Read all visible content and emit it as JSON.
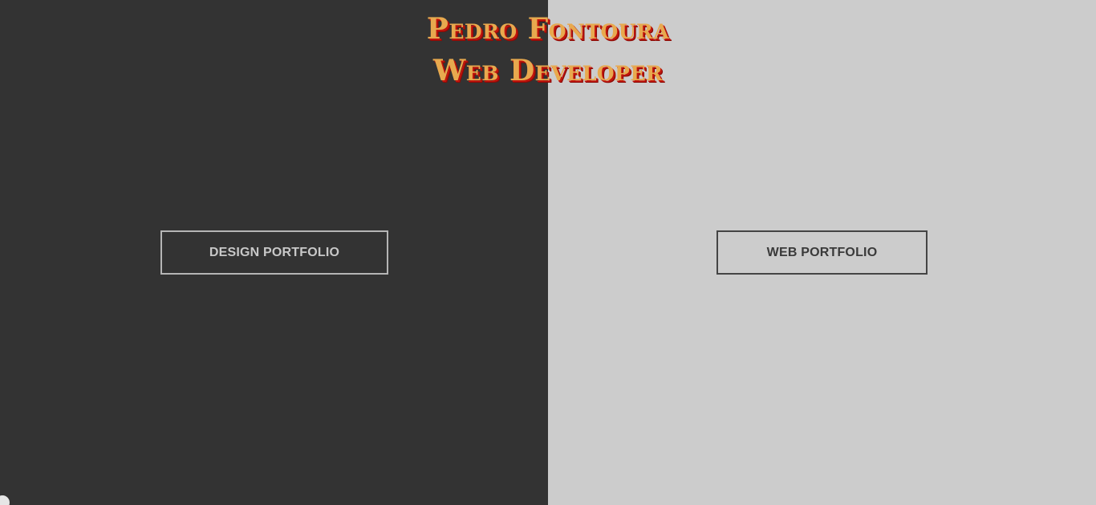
{
  "header": {
    "name": "Pedro Fontoura",
    "role": "Web Developer"
  },
  "left_pane": {
    "button_label": "DESIGN PORTFOLIO"
  },
  "right_pane": {
    "button_label": "WEB PORTFOLIO"
  },
  "colors": {
    "left_background": "#333333",
    "right_background": "#cccccc",
    "title_fill": "#e8a94e",
    "title_shadow": "#c0140c"
  }
}
